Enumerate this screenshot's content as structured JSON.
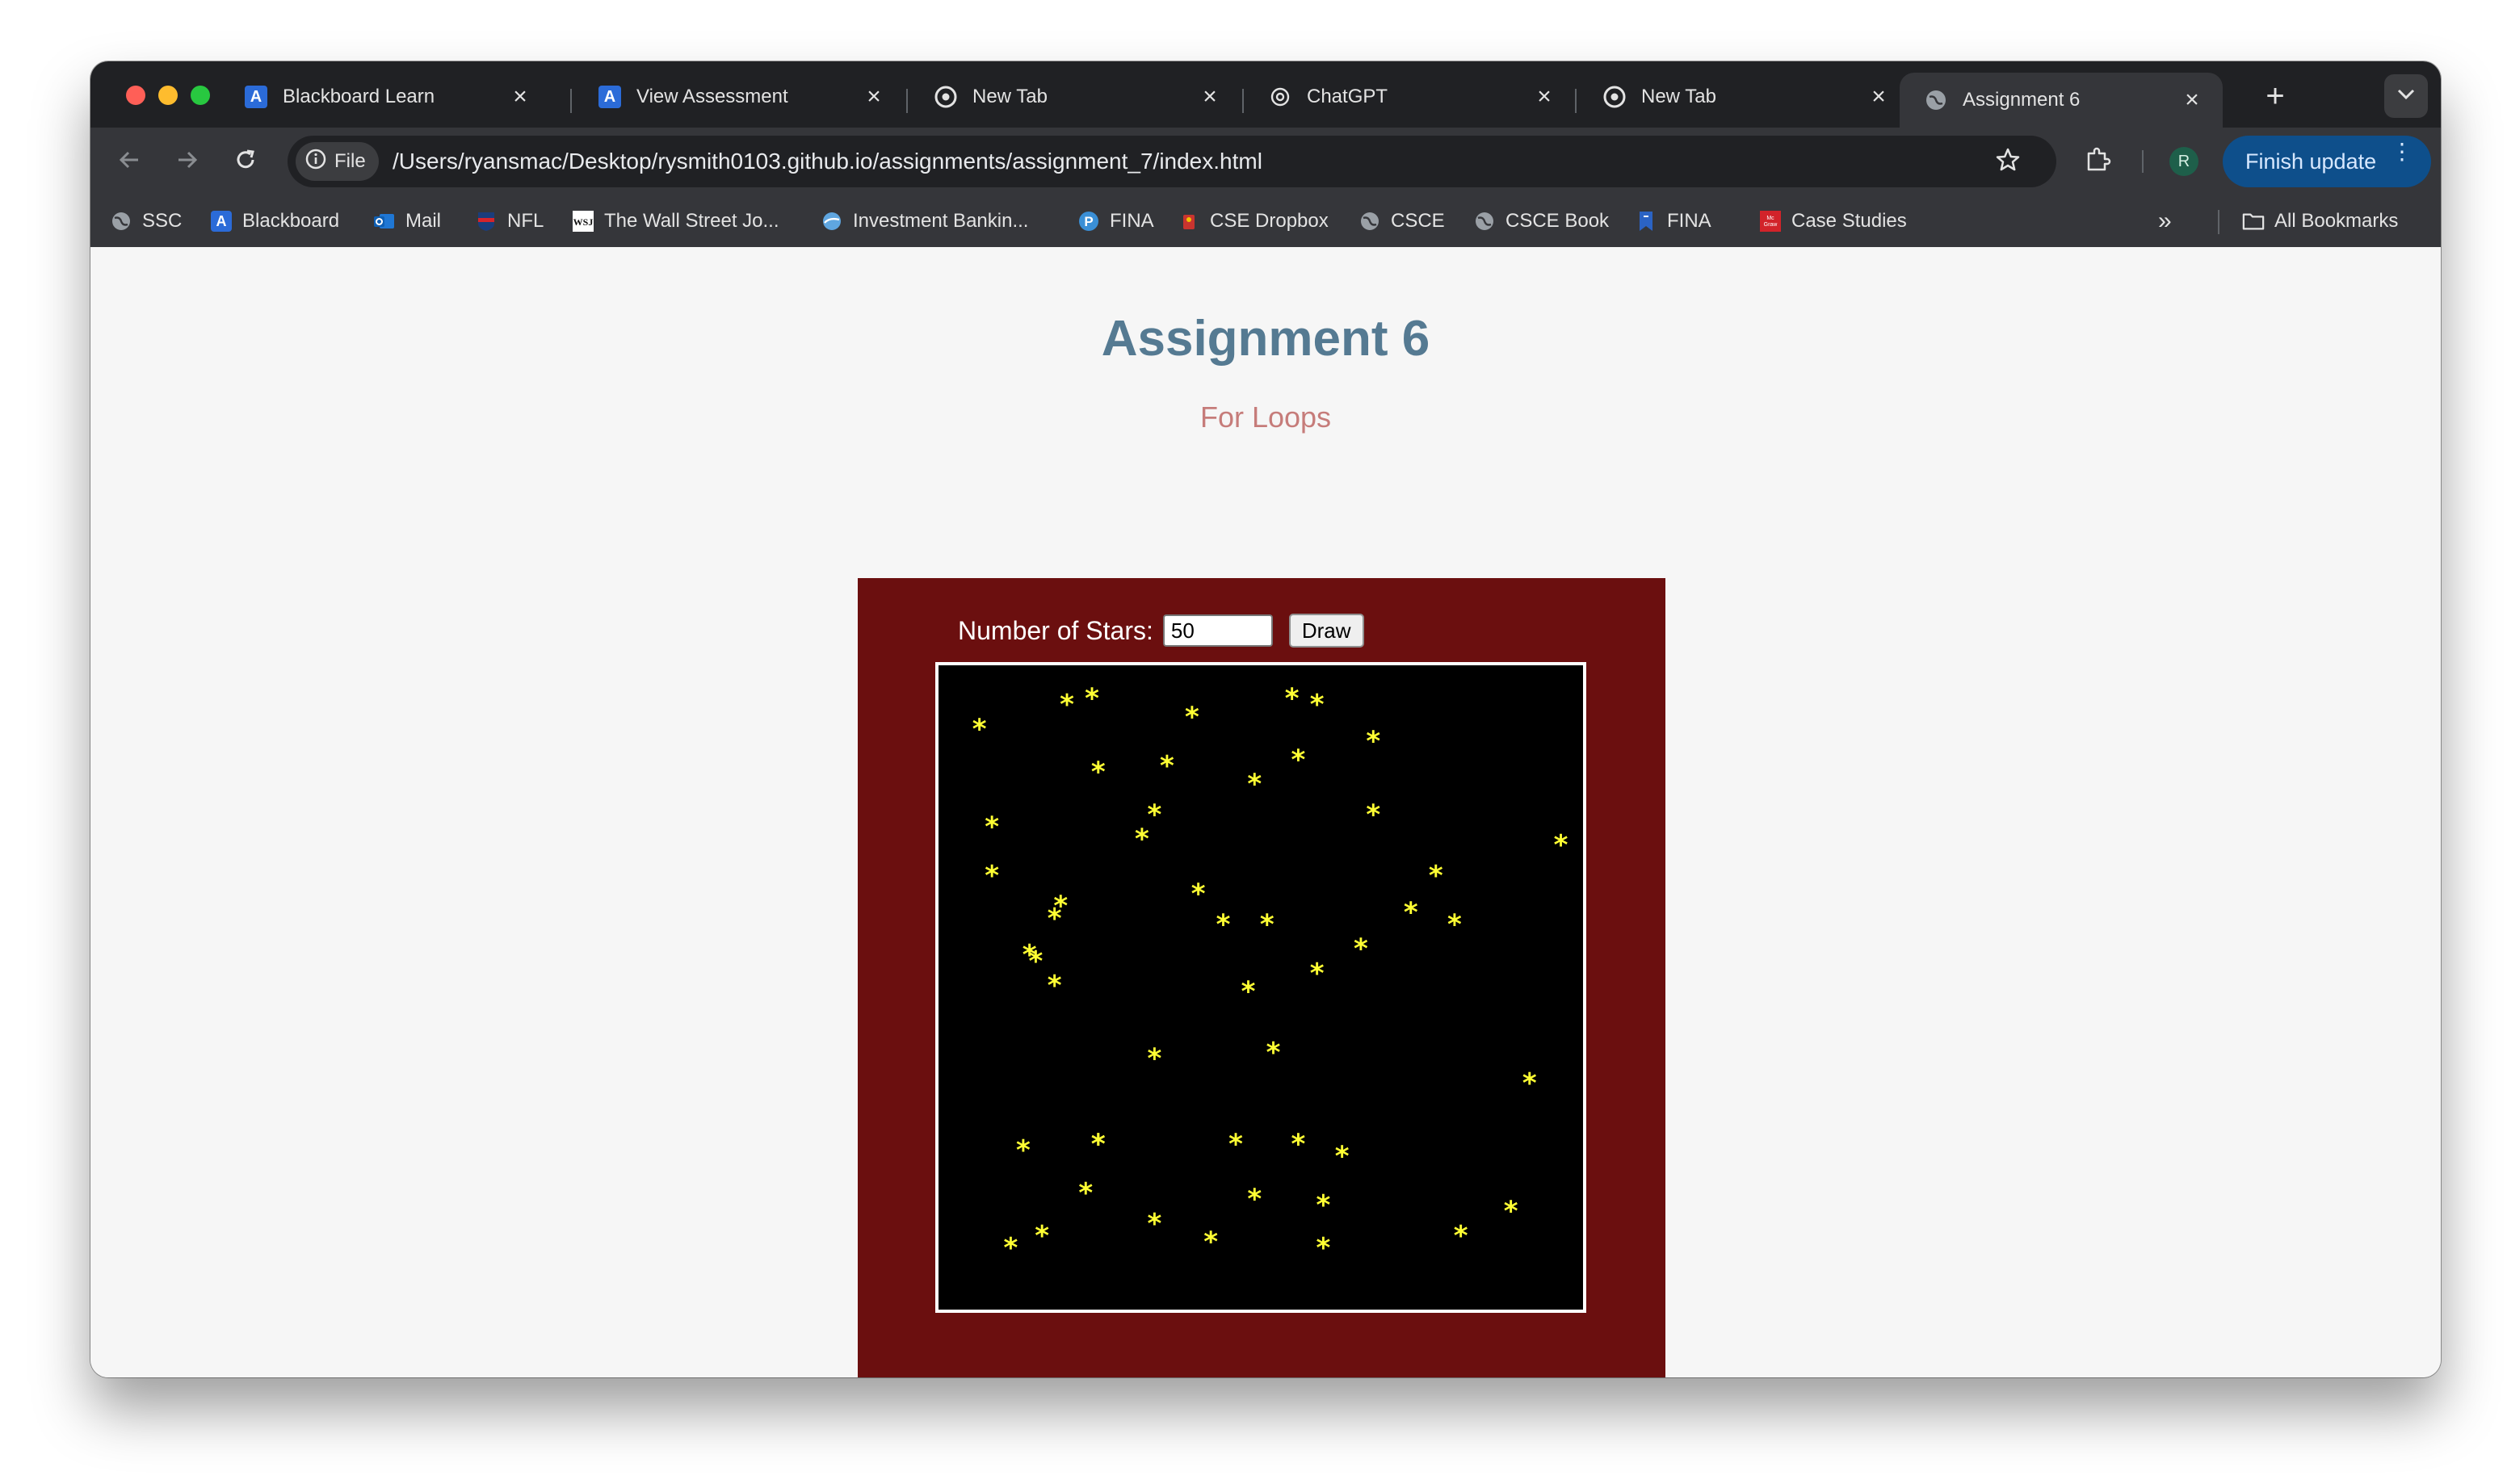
{
  "browser": {
    "tabs": [
      {
        "title": "Blackboard Learn",
        "icon": "blackboard-icon"
      },
      {
        "title": "View Assessment",
        "icon": "blackboard-icon"
      },
      {
        "title": "New Tab",
        "icon": "chrome-icon"
      },
      {
        "title": "ChatGPT",
        "icon": "openai-icon"
      },
      {
        "title": "New Tab",
        "icon": "chrome-icon"
      },
      {
        "title": "Assignment 6",
        "icon": "globe-icon",
        "active": true
      }
    ],
    "tab_close": "×",
    "new_tab": "+",
    "address": {
      "chip_label": "File",
      "url": "/Users/ryansmac/Desktop/rysmith0103.github.io/assignments/assignment_7/index.html"
    },
    "profile_initial": "R",
    "update_button": "Finish update",
    "bookmarks": [
      {
        "label": "SSC",
        "icon": "globe-icon"
      },
      {
        "label": "Blackboard",
        "icon": "blackboard-icon"
      },
      {
        "label": "Mail",
        "icon": "outlook-icon"
      },
      {
        "label": "NFL",
        "icon": "nfl-icon"
      },
      {
        "label": "The Wall Street Jo...",
        "icon": "wsj-icon"
      },
      {
        "label": "Investment Bankin...",
        "icon": "globe-icon"
      },
      {
        "label": "FINA",
        "icon": "pearson-icon"
      },
      {
        "label": "CSE Dropbox",
        "icon": "dropbox-icon"
      },
      {
        "label": "CSCE",
        "icon": "globe-icon"
      },
      {
        "label": "CSCE Book",
        "icon": "globe-icon"
      },
      {
        "label": "FINA",
        "icon": "bookmark-icon"
      },
      {
        "label": "Case Studies",
        "icon": "mcgraw-hill-icon"
      }
    ],
    "bookmarks_overflow": "»",
    "all_bookmarks": "All Bookmarks"
  },
  "page": {
    "title": "Assignment 6",
    "subtitle": "For Loops",
    "form": {
      "label": "Number of Stars:",
      "input_value": "50",
      "button_label": "Draw"
    },
    "star_glyph": "*",
    "colors": {
      "title": "#557a92",
      "subtitle": "#c67c7a",
      "panel": "#6b0f0f",
      "canvas": "#000000",
      "star": "#ffff33"
    },
    "stars": [
      [
        0.05,
        0.08
      ],
      [
        0.19,
        0.04
      ],
      [
        0.23,
        0.03
      ],
      [
        0.39,
        0.06
      ],
      [
        0.55,
        0.03
      ],
      [
        0.59,
        0.04
      ],
      [
        0.68,
        0.1
      ],
      [
        0.24,
        0.15
      ],
      [
        0.35,
        0.14
      ],
      [
        0.49,
        0.17
      ],
      [
        0.56,
        0.13
      ],
      [
        0.07,
        0.24
      ],
      [
        0.33,
        0.22
      ],
      [
        0.31,
        0.26
      ],
      [
        0.68,
        0.22
      ],
      [
        0.98,
        0.27
      ],
      [
        0.07,
        0.32
      ],
      [
        0.78,
        0.32
      ],
      [
        0.18,
        0.37
      ],
      [
        0.17,
        0.39
      ],
      [
        0.4,
        0.35
      ],
      [
        0.44,
        0.4
      ],
      [
        0.51,
        0.4
      ],
      [
        0.74,
        0.38
      ],
      [
        0.81,
        0.4
      ],
      [
        0.13,
        0.45
      ],
      [
        0.14,
        0.46
      ],
      [
        0.66,
        0.44
      ],
      [
        0.17,
        0.5
      ],
      [
        0.48,
        0.51
      ],
      [
        0.59,
        0.48
      ],
      [
        0.33,
        0.62
      ],
      [
        0.52,
        0.61
      ],
      [
        0.93,
        0.66
      ],
      [
        0.12,
        0.77
      ],
      [
        0.24,
        0.76
      ],
      [
        0.46,
        0.76
      ],
      [
        0.56,
        0.76
      ],
      [
        0.63,
        0.78
      ],
      [
        0.22,
        0.84
      ],
      [
        0.49,
        0.85
      ],
      [
        0.6,
        0.86
      ],
      [
        0.33,
        0.89
      ],
      [
        0.9,
        0.87
      ],
      [
        0.15,
        0.91
      ],
      [
        0.1,
        0.93
      ],
      [
        0.42,
        0.92
      ],
      [
        0.6,
        0.93
      ],
      [
        0.82,
        0.91
      ],
      [
        0.24,
        0.76
      ]
    ]
  }
}
